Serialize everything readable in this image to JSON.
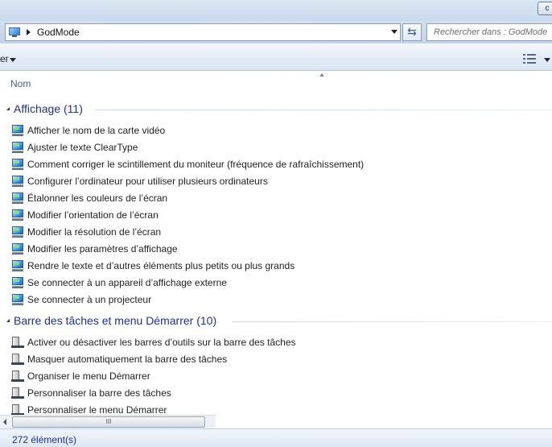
{
  "chrome": {
    "corner_button": "c"
  },
  "address": {
    "crumb": "GodMode",
    "search_placeholder": "Rechercher dans : GodMode"
  },
  "toolbar": {
    "left_partial_label": "er"
  },
  "columns": {
    "name": "Nom"
  },
  "groups": [
    {
      "title": "Affichage (11)",
      "icon": "display-settings-icon",
      "items": [
        "Afficher le nom de la carte vidéo",
        "Ajuster le texte ClearType",
        "Comment corriger le scintillement du moniteur (fréquence de rafraîchissement)",
        "Configurer l’ordinateur pour utiliser plusieurs ordinateurs",
        "Étalonner les couleurs de l’écran",
        "Modifier l’orientation de l’écran",
        "Modifier la résolution de l’écran",
        "Modifier les paramètres d’affichage",
        "Rendre le texte et d’autres éléments plus petits ou plus grands",
        "Se connecter à un appareil d’affichage externe",
        "Se connecter à un projecteur"
      ]
    },
    {
      "title": "Barre des tâches et menu Démarrer (10)",
      "icon": "taskbar-start-menu-icon",
      "items": [
        "Activer ou désactiver les barres d’outils sur la barre des tâches",
        "Masquer automatiquement la barre des tâches",
        "Organiser le menu Démarrer",
        "Personnaliser la barre des tâches",
        "Personnaliser le menu Démarrer"
      ]
    }
  ],
  "scrollbar": {
    "thumb_grip": "III"
  },
  "status": {
    "count": "272 élément(s)"
  }
}
